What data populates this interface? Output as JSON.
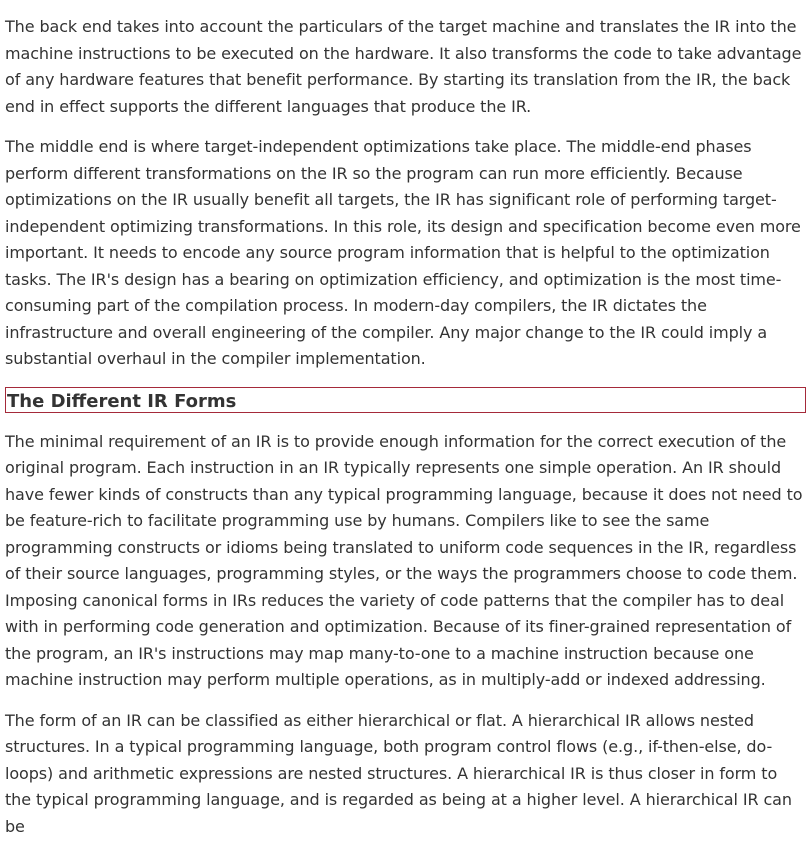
{
  "article": {
    "paragraphs_before": [
      "The back end takes into account the particulars of the target machine and translates the IR into the machine instructions to be executed on the hardware. It also transforms the code to take advantage of any hardware features that benefit performance. By starting its translation from the IR, the back end in effect supports the different languages that produce the IR.",
      "The middle end is where target-independent optimizations take place. The middle-end phases perform different transformations on the IR so the program can run more efficiently. Because optimizations on the IR usually benefit all targets, the IR has significant role of performing target-independent optimizing transformations. In this role, its design and specification become even more important. It needs to encode any source program information that is helpful to the optimization tasks. The IR's design has a bearing on optimization efficiency, and optimization is the most time-consuming part of the compilation process. In modern-day compilers, the IR dictates the infrastructure and overall engineering of the compiler. Any major change to the IR could imply a substantial overhaul in the compiler implementation."
    ],
    "section_heading": "The Different IR Forms",
    "paragraphs_after": [
      "The minimal requirement of an IR is to provide enough information for the correct execution of the original program. Each instruction in an IR typically represents one simple operation. An IR should have fewer kinds of constructs than any typical programming language, because it does not need to be feature-rich to facilitate programming use by humans. Compilers like to see the same programming constructs or idioms being translated to uniform code sequences in the IR, regardless of their source languages, programming styles, or the ways the programmers choose to code them. Imposing canonical forms in IRs reduces the variety of code patterns that the compiler has to deal with in performing code generation and optimization. Because of its finer-grained representation of the program, an IR's instructions may map many-to-one to a machine instruction because one machine instruction may perform multiple operations, as in multiply-add or indexed addressing.",
      "The form of an IR can be classified as either hierarchical or flat. A hierarchical IR allows nested structures. In a typical programming language, both program control flows (e.g., if-then-else, do-loops) and arithmetic expressions are nested structures. A hierarchical IR is thus closer in form to the typical programming language, and is regarded as being at a higher level. A hierarchical IR can be"
    ]
  },
  "colors": {
    "text": "#333333",
    "heading_border": "#a52a3a",
    "background": "#ffffff"
  }
}
